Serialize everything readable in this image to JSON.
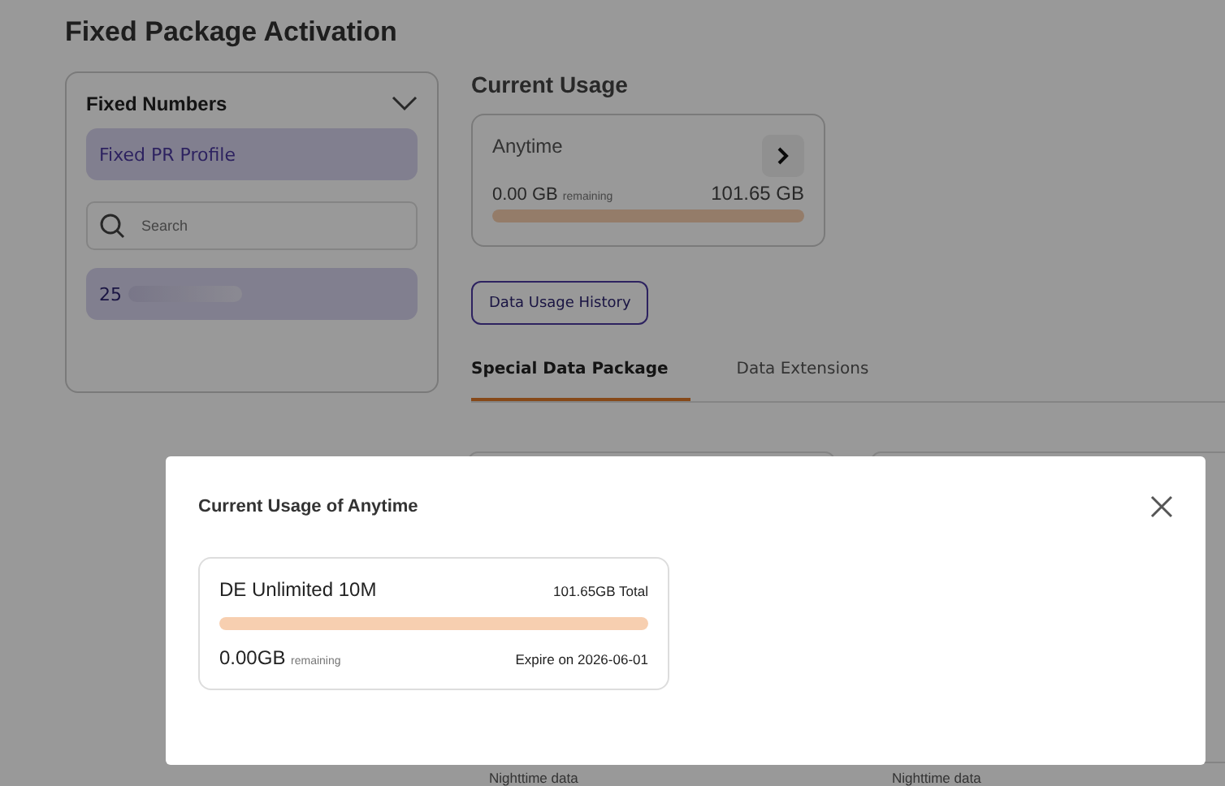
{
  "page": {
    "title": "Fixed Package Activation"
  },
  "numbers_panel": {
    "title": "Fixed Numbers",
    "expanded": true,
    "profile": "Fixed PR Profile",
    "search": {
      "placeholder": "Search"
    },
    "numbers": [
      {
        "label": "25",
        "selected": true
      }
    ]
  },
  "current_usage": {
    "title": "Current Usage",
    "card": {
      "name": "Anytime",
      "remaining": "0.00 GB",
      "remaining_label": "remaining",
      "total": "101.65 GB",
      "level": 1
    },
    "history_button": "Data Usage History"
  },
  "tabs": [
    {
      "label": "Special Data Package",
      "selected": true
    },
    {
      "label": "Data Extensions",
      "selected": false
    }
  ],
  "packages": [
    {
      "label": "Nighttime data"
    },
    {
      "label": "Nighttime data"
    }
  ],
  "dialog": {
    "title": "Current Usage of Anytime",
    "package": {
      "name": "DE Unlimited 10M",
      "total": "101.65GB Total",
      "level": 1,
      "remaining": "0.00GB",
      "remaining_label": "remaining",
      "expiry": "Expire on 2026-06-01"
    }
  }
}
